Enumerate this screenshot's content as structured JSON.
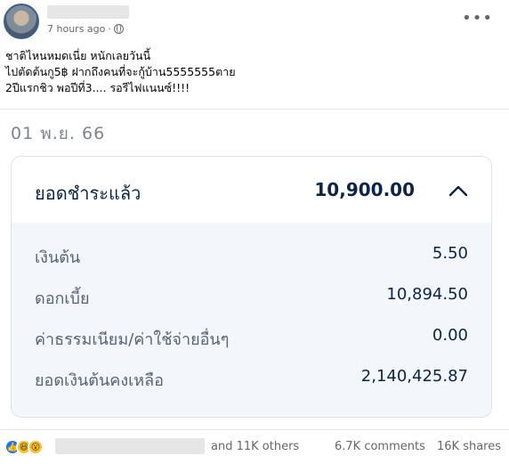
{
  "post": {
    "time": "7 hours ago",
    "separator": "·",
    "text_lines": [
      "ชาติไหนหมดเนี่ย หนักเลยวันนี้",
      "ไปตัดต้นกู5฿ ฝากถึงคนที่จะกู้บ้าน5555555ตาย",
      "2ปีแรกชิว พอปีที่3.... รอรีไฟแนนซ์!!!!"
    ]
  },
  "slip": {
    "date": "01 พ.ย. 66",
    "title": "ยอดชำระแล้ว",
    "total": "10,900.00",
    "rows": [
      {
        "label": "เงินต้น",
        "value": "5.50"
      },
      {
        "label": "ดอกเบี้ย",
        "value": "10,894.50"
      },
      {
        "label": "ค่าธรรมเนียม/ค่าใช้จ่ายอื่นๆ",
        "value": "0.00"
      },
      {
        "label": "ยอดเงินต้นคงเหลือ",
        "value": "2,140,425.87"
      }
    ]
  },
  "footer": {
    "others": "and 11K others",
    "comments": "6.7K comments",
    "shares": "16K shares"
  },
  "icons": {
    "like": "like-icon",
    "haha": "haha-icon",
    "wow": "wow-icon",
    "globe": "globe-icon",
    "more": "more-icon"
  },
  "colors": {
    "accent": "#1877f2",
    "slip_text": "#0b2447",
    "slip_body_bg": "#f3f6fa"
  }
}
